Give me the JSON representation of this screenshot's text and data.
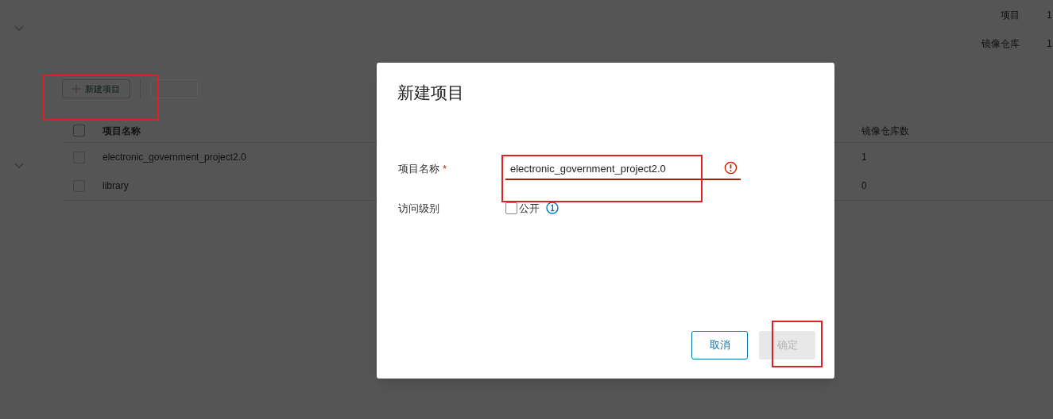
{
  "background": {
    "stats": [
      {
        "label": "项目",
        "value": "1"
      },
      {
        "label": "镜像仓库",
        "value": "1"
      }
    ],
    "toolbar": {
      "new_button": "新建项目"
    },
    "table": {
      "all_checked": false,
      "columns": [
        "项目名称",
        "镜像仓库数"
      ],
      "rows": [
        {
          "cells": [
            "electronic_government_project2.0",
            "1"
          ],
          "checked": false
        },
        {
          "cells": [
            "library",
            "0"
          ],
          "checked": false
        }
      ]
    }
  },
  "dialog": {
    "title": "新建项目",
    "fields": [
      {
        "kind": "text",
        "label": "项目名称",
        "required_mark": "*",
        "value": "electronic_government_project2.0",
        "invalid": true
      },
      {
        "kind": "checkbox",
        "label": "访问级别",
        "option": "公开",
        "checked": false
      }
    ],
    "buttons": [
      {
        "label": "取消",
        "disabled": false
      },
      {
        "label": "确定",
        "disabled": true
      }
    ]
  }
}
